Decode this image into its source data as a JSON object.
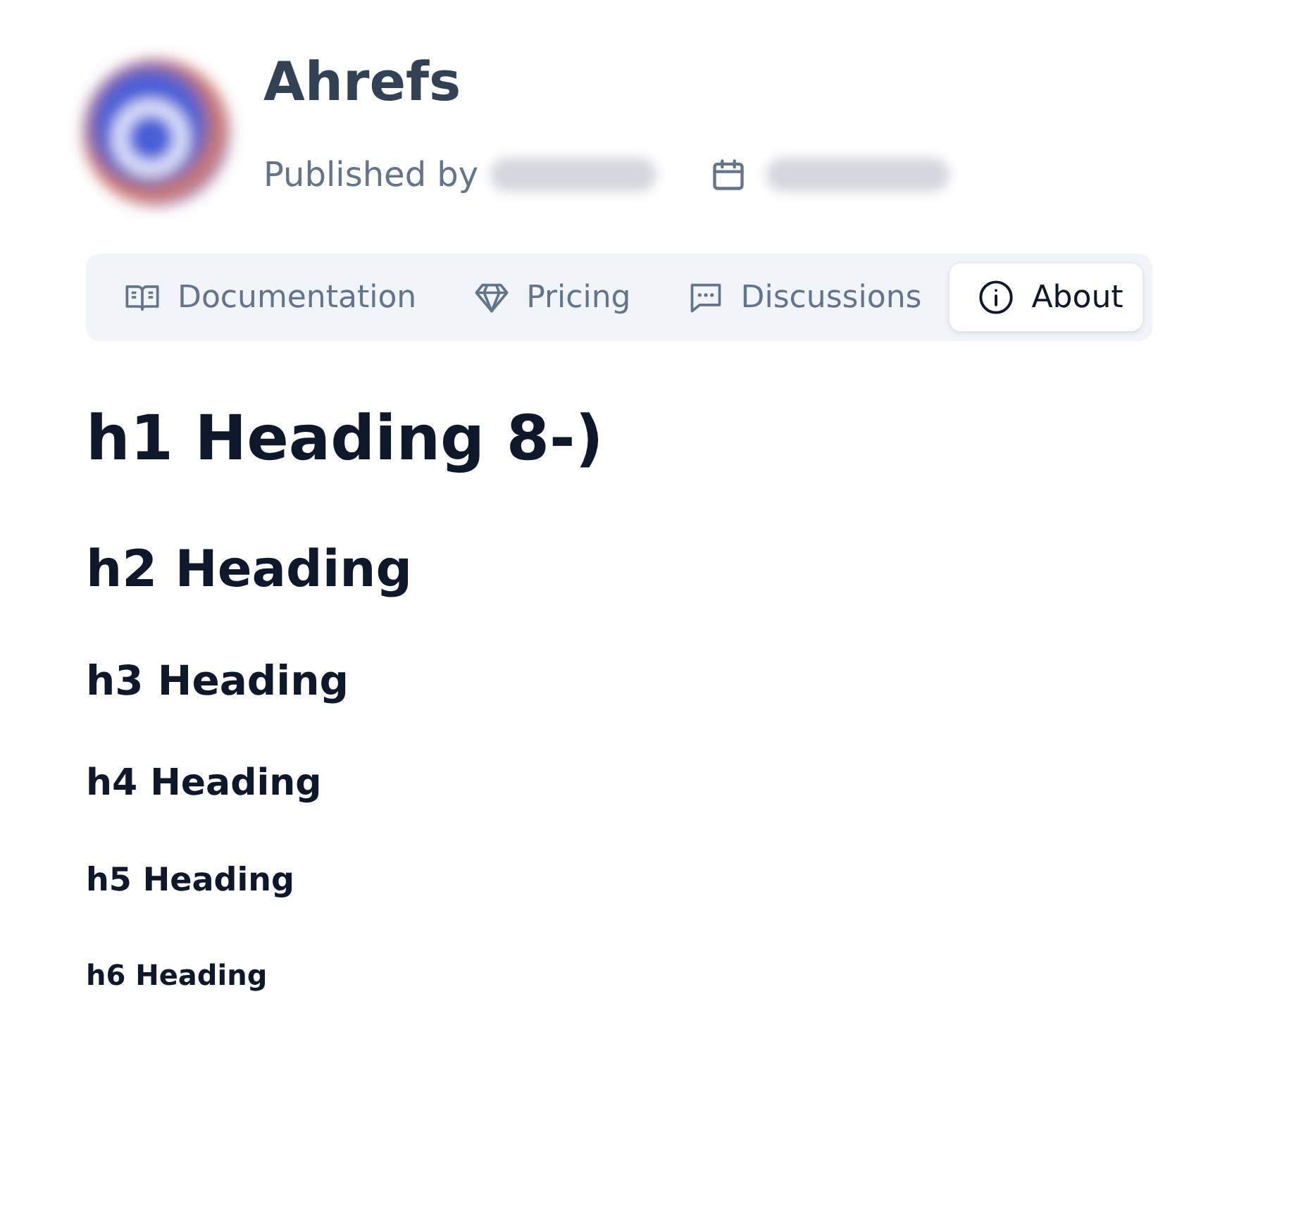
{
  "header": {
    "title": "Ahrefs",
    "published_label": "Published by"
  },
  "tabs": [
    {
      "label": "Documentation",
      "kind": "book",
      "selected": false
    },
    {
      "label": "Pricing",
      "kind": "diamond",
      "selected": false
    },
    {
      "label": "Discussions",
      "kind": "message",
      "selected": false
    },
    {
      "label": "About",
      "kind": "info",
      "selected": true
    }
  ],
  "headings": [
    {
      "kind": "h1",
      "text": "h1 Heading 8-)"
    },
    {
      "kind": "h2",
      "text": "h2 Heading"
    },
    {
      "kind": "h3",
      "text": "h3 Heading"
    },
    {
      "kind": "h4",
      "text": "h4 Heading"
    },
    {
      "kind": "h5",
      "text": "h5 Heading"
    },
    {
      "kind": "h6",
      "text": "h6 Heading"
    }
  ]
}
